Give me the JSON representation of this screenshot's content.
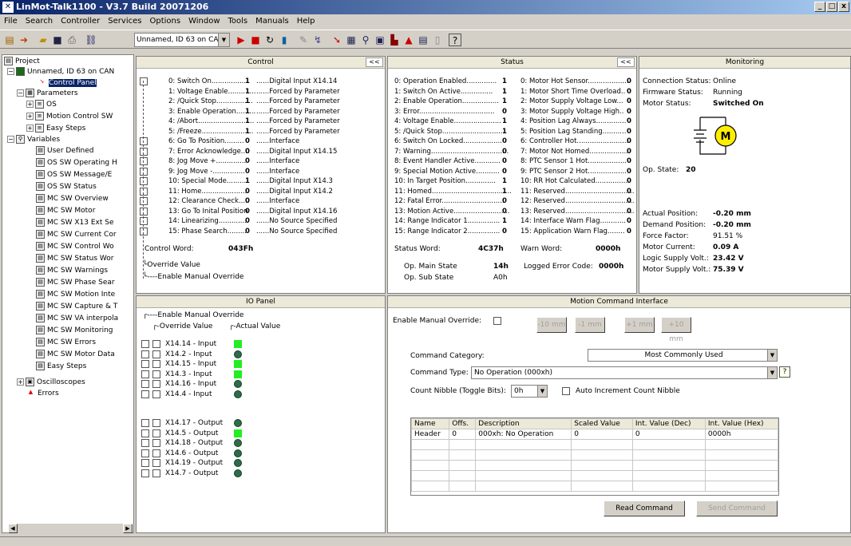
{
  "title": "LinMot-Talk1100 - V3.7 Build 20071206",
  "menu": [
    "File",
    "Search",
    "Controller",
    "Services",
    "Options",
    "Window",
    "Tools",
    "Manuals",
    "Help"
  ],
  "device": "Unnamed, ID 63 on CAN",
  "tree": {
    "project": "Project",
    "device": "Unnamed, ID 63 on CAN",
    "control_panel": "Control Panel",
    "parameters": "Parameters",
    "os": "OS",
    "mcsw": "Motion Control SW",
    "easy_steps": "Easy Steps",
    "variables": "Variables",
    "vars": [
      "User Defined",
      "OS SW Operating H",
      "OS SW Message/E",
      "OS SW Status",
      "MC SW Overview",
      "MC SW Motor",
      "MC SW X13 Ext Se",
      "MC SW Current Cor",
      "MC SW Control Wo",
      "MC SW Status Wor",
      "MC SW Warnings",
      "MC SW Phase Sear",
      "MC SW Motion Inte",
      "MC SW Capture & T",
      "MC SW VA interpola",
      "MC SW Monitoring",
      "MC SW Errors",
      "MC SW Motor Data",
      "Easy Steps"
    ],
    "oscilloscopes": "Oscilloscopes",
    "errors": "Errors"
  },
  "control": {
    "header": "Control",
    "collapse": "<<",
    "bits": [
      {
        "l": "0: Switch On.................",
        "v": "1",
        "s": "......Digital Input X14.14"
      },
      {
        "l": "1: Voltage Enable.............",
        "v": "1",
        "s": "......Forced by Parameter"
      },
      {
        "l": "2: /Quick Stop.................",
        "v": "1",
        "s": "......Forced by Parameter"
      },
      {
        "l": "3: Enable Operation.........",
        "v": "1",
        "s": "......Forced by Parameter"
      },
      {
        "l": "4: /Abort..........................",
        "v": "1",
        "s": "......Forced by Parameter"
      },
      {
        "l": "5: /Freeze........................",
        "v": "1",
        "s": "......Forced by Parameter"
      },
      {
        "l": "6: Go To Position.........",
        "v": "0",
        "s": "......Interface"
      },
      {
        "l": "7: Error Acknowledge....",
        "v": "0",
        "s": "......Digital Input X14.15"
      },
      {
        "l": "8: Jog Move +..............",
        "v": "0",
        "s": "......Interface"
      },
      {
        "l": "9: Jog Move -...............",
        "v": "0",
        "s": "......Interface"
      },
      {
        "l": "10: Special Mode..........",
        "v": "1",
        "s": "......Digital Input X14.3"
      },
      {
        "l": "11: Home......................",
        "v": "0",
        "s": "......Digital Input X14.2"
      },
      {
        "l": "12: Clearance Check.....",
        "v": "0",
        "s": "......Interface"
      },
      {
        "l": "13: Go To Inital Position",
        "v": "0",
        "s": "......Digital Input X14.16"
      },
      {
        "l": "14: Linearizing..............",
        "v": "0",
        "s": "......No Source Specified"
      },
      {
        "l": "15: Phase Search.........",
        "v": "0",
        "s": "......No Source Specified"
      }
    ],
    "cw_label": "Control Word:",
    "cw_value": "043Fh",
    "override_value": "Override Value",
    "enable_manual": "Enable Manual Override"
  },
  "status": {
    "header": "Status",
    "collapse": "<<",
    "left": [
      {
        "l": "0: Operation Enabled..............",
        "v": "1"
      },
      {
        "l": "1: Switch On Active...............",
        "v": "1"
      },
      {
        "l": "2: Enable Operation.................",
        "v": "1"
      },
      {
        "l": "3: Error...................................",
        "v": "0"
      },
      {
        "l": "4: Voltage Enable......................",
        "v": "1"
      },
      {
        "l": "5: /Quick Stop.............................",
        "v": "1"
      },
      {
        "l": "6: Switch On Locked..................",
        "v": "0"
      },
      {
        "l": "7: Warning....................................",
        "v": "0"
      },
      {
        "l": "8: Event Handler Active............",
        "v": "0"
      },
      {
        "l": "9: Special Motion Active...........",
        "v": "0"
      },
      {
        "l": "10: In Target Position..............",
        "v": "1"
      },
      {
        "l": "11: Homed.....................................",
        "v": "1"
      },
      {
        "l": "12: Fatal Error.............................",
        "v": "0"
      },
      {
        "l": "13: Motion Active..........................",
        "v": "0"
      },
      {
        "l": "14: Range Indicator 1...............",
        "v": "1"
      },
      {
        "l": "15: Range Indicator 2...............",
        "v": "0"
      }
    ],
    "right": [
      {
        "l": "0: Motor Hot Sensor...................",
        "v": "0"
      },
      {
        "l": "1: Motor Short Time Overload..",
        "v": "0"
      },
      {
        "l": "2: Motor Supply Voltage Low...",
        "v": "0"
      },
      {
        "l": "3: Motor Supply Voltage High..",
        "v": "0"
      },
      {
        "l": "4: Position Lag Always..............",
        "v": "0"
      },
      {
        "l": "5: Position Lag Standing...........",
        "v": "0"
      },
      {
        "l": "6: Controller Hot........................",
        "v": "0"
      },
      {
        "l": "7: Motor Not Homed...................",
        "v": "0"
      },
      {
        "l": "8: PTC Sensor 1 Hot..................",
        "v": "0"
      },
      {
        "l": "9: PTC Sensor 2 Hot..................",
        "v": "0"
      },
      {
        "l": "10: RR Hot Calculated...............",
        "v": "0"
      },
      {
        "l": "11: Reserved................................",
        "v": "0"
      },
      {
        "l": "12: Reserved................................",
        "v": "0"
      },
      {
        "l": "13: Reserved................................",
        "v": "0"
      },
      {
        "l": "14: Interface Warn Flag............",
        "v": "0"
      },
      {
        "l": "15: Application Warn Flag........",
        "v": "0"
      }
    ],
    "sw_label": "Status Word:",
    "sw_value": "4C37h",
    "ww_label": "Warn Word:",
    "ww_value": "0000h",
    "main_label": "Op. Main State",
    "main_value": "14h",
    "sub_label": "Op. Sub State",
    "sub_value": "A0h",
    "log_label": "Logged Error Code:",
    "log_value": "0000h"
  },
  "monitoring": {
    "header": "Monitoring",
    "conn_label": "Connection Status:",
    "conn_value": "Online",
    "fw_label": "Firmware Status:",
    "fw_value": "Running",
    "motor_label": "Motor Status:",
    "motor_value": "Switched On",
    "motor_symbol": "M",
    "op_label": "Op. State:",
    "op_value": "20",
    "values": [
      {
        "l": "Actual Position:",
        "v": "-0.20 mm",
        "b": true
      },
      {
        "l": "Demand Position:",
        "v": "-0.20 mm",
        "b": true
      },
      {
        "l": "Force Factor:",
        "v": "91.51 %",
        "b": false
      },
      {
        "l": "Motor Current:",
        "v": "0.09 A",
        "b": true
      },
      {
        "l": "Logic Supply Volt.:",
        "v": "23.42 V",
        "b": true
      },
      {
        "l": "Motor Supply Volt.:",
        "v": "75.39 V",
        "b": true
      }
    ]
  },
  "io": {
    "header": "IO Panel",
    "enable_manual": "Enable Manual Override",
    "override_value": "Override Value",
    "actual_value": "Actual Value",
    "inputs": [
      {
        "n": "X14.14 - Input",
        "on": true
      },
      {
        "n": "X14.2  - Input",
        "on": false
      },
      {
        "n": "X14.15 - Input",
        "on": true
      },
      {
        "n": "X14.3  - Input",
        "on": true
      },
      {
        "n": "X14.16 - Input",
        "on": false
      },
      {
        "n": "X14.4  - Input",
        "on": false
      }
    ],
    "outputs": [
      {
        "n": "X14.17 - Output",
        "on": false
      },
      {
        "n": "X14.5  - Output",
        "on": true
      },
      {
        "n": "X14.18 - Output",
        "on": false
      },
      {
        "n": "X14.6  - Output",
        "on": false
      },
      {
        "n": "X14.19 - Output",
        "on": false
      },
      {
        "n": "X14.7  - Output",
        "on": false
      }
    ]
  },
  "mci": {
    "header": "Motion Command Interface",
    "enable_manual": "Enable Manual Override:",
    "jog": [
      "-10 mm",
      "-1 mm",
      "+1 mm",
      "+10 mm"
    ],
    "cat_label": "Command Category:",
    "cat_value": "Most Commonly Used",
    "type_label": "Command Type:",
    "type_value": "No Operation (000xh)",
    "help_icon": "?",
    "count_label": "Count Nibble (Toggle Bits):",
    "count_value": "0h",
    "auto_label": "Auto Increment Count Nibble",
    "columns": [
      "Name",
      "Offs.",
      "Description",
      "Scaled Value",
      "Int. Value (Dec)",
      "Int. Value (Hex)"
    ],
    "rows": [
      [
        "Header",
        "0",
        "000xh: No Operation",
        "0",
        "0",
        "0000h"
      ]
    ],
    "read_btn": "Read Command",
    "send_btn": "Send Command"
  }
}
